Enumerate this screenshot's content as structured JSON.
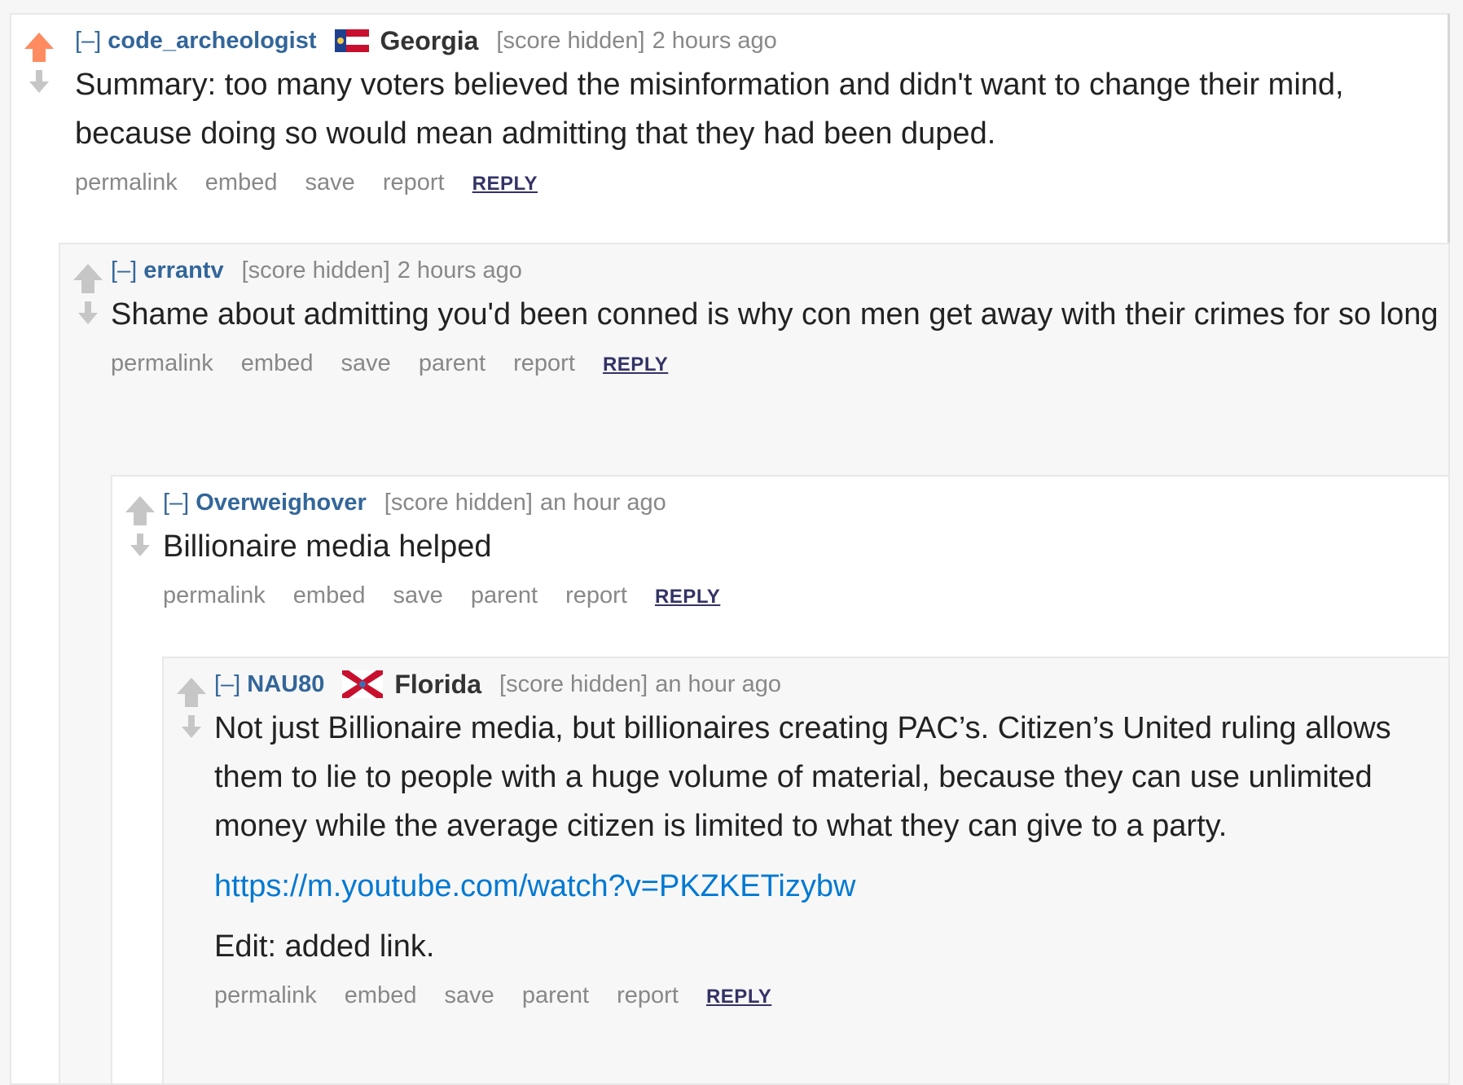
{
  "colors": {
    "upvote_active": "#ff8b60",
    "arrow_inactive": "#c6c6c6",
    "link": "#0079d3",
    "author": "#336699"
  },
  "comments": [
    {
      "expand": "[–]",
      "author": "code_archeologist",
      "flair": "Georgia",
      "flair_icon": "georgia-flag-icon",
      "score": "[score hidden]",
      "time": "2 hours ago",
      "body": [
        "Summary: too many voters believed the misinformation and didn't want to change their mind, because doing so would mean admitting that they had been duped."
      ],
      "buttons": [
        "permalink",
        "embed",
        "save",
        "report"
      ],
      "reply": "REPLY"
    },
    {
      "expand": "[–]",
      "author": "errantv",
      "score": "[score hidden]",
      "time": "2 hours ago",
      "body": [
        "Shame about admitting you'd been conned is why con men get away with their crimes for so long"
      ],
      "buttons": [
        "permalink",
        "embed",
        "save",
        "parent",
        "report"
      ],
      "reply": "REPLY"
    },
    {
      "expand": "[–]",
      "author": "Overweighover",
      "score": "[score hidden]",
      "time": "an hour ago",
      "body": [
        "Billionaire media helped"
      ],
      "buttons": [
        "permalink",
        "embed",
        "save",
        "parent",
        "report"
      ],
      "reply": "REPLY"
    },
    {
      "expand": "[–]",
      "author": "NAU80",
      "flair": "Florida",
      "flair_icon": "florida-flag-icon",
      "score": "[score hidden]",
      "time": "an hour ago",
      "body": [
        "Not just Billionaire media, but billionaires creating PAC’s. Citizen’s United ruling allows them to lie to people with a huge volume of material, because they can use unlimited money while the average citizen is limited to what they can give to a party.",
        "https://m.youtube.com/watch?v=PKZKETizybw",
        "Edit: added link."
      ],
      "buttons": [
        "permalink",
        "embed",
        "save",
        "parent",
        "report"
      ],
      "reply": "REPLY"
    }
  ]
}
